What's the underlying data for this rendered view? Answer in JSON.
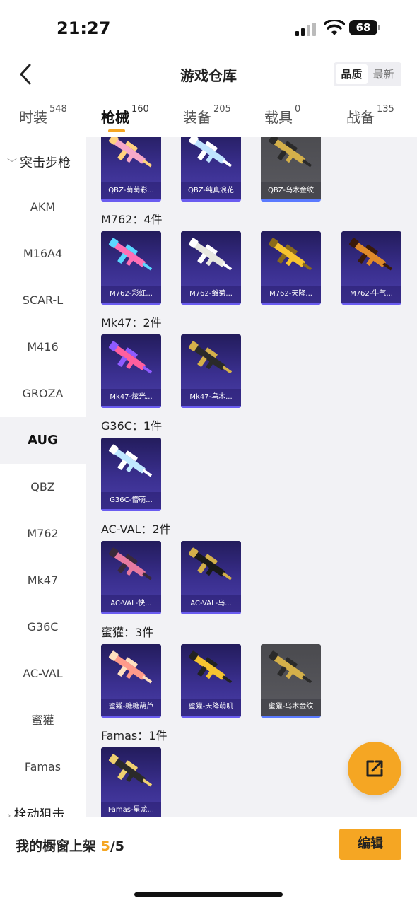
{
  "status": {
    "time": "21:27",
    "battery": "68"
  },
  "header": {
    "title": "游戏仓库",
    "sort": [
      "品质",
      "最新"
    ],
    "sort_active": 0
  },
  "tabs": [
    {
      "label": "时装",
      "count": "548"
    },
    {
      "label": "枪械",
      "count": "160"
    },
    {
      "label": "装备",
      "count": "205"
    },
    {
      "label": "载具",
      "count": "0"
    },
    {
      "label": "战备",
      "count": "135"
    }
  ],
  "sidebar": {
    "category": "突击步枪",
    "items": [
      "AKM",
      "M16A4",
      "SCAR-L",
      "M416",
      "GROZA",
      "AUG",
      "QBZ",
      "M762",
      "Mk47",
      "G36C",
      "AC-VAL",
      "蜜獾",
      "Famas"
    ],
    "active": "AUG",
    "next_category": "栓动狙击"
  },
  "groups": [
    {
      "title": "",
      "items": [
        "QBZ-萌萌彩...",
        "QBZ-纯真浪花",
        "QBZ-乌木金纹"
      ]
    },
    {
      "title": "M762：4件",
      "items": [
        "M762-彩虹...",
        "M762-雏菊...",
        "M762-天降...",
        "M762-牛气..."
      ]
    },
    {
      "title": "Mk47：2件",
      "items": [
        "Mk47-炫光...",
        "Mk47-乌木..."
      ]
    },
    {
      "title": "G36C：1件",
      "items": [
        "G36C-懵萌..."
      ]
    },
    {
      "title": "AC-VAL：2件",
      "items": [
        "AC-VAL-快...",
        "AC-VAL-乌..."
      ]
    },
    {
      "title": "蜜獾：3件",
      "items": [
        "蜜獾-糖糖葫芦",
        "蜜獾-天降萌叽",
        "蜜獾-乌木金纹"
      ]
    },
    {
      "title": "Famas：1件",
      "items": [
        "Famas-星龙..."
      ]
    }
  ],
  "bottom": {
    "label": "我的橱窗上架 ",
    "current": "5",
    "total": "/5",
    "edit": "编辑"
  },
  "colors": {
    "accent": "#f5a623",
    "card_purple": "#3a2f8f",
    "card_grey": "#555559"
  },
  "icons": {
    "back": "chevron-left-icon",
    "share": "share-icon"
  }
}
